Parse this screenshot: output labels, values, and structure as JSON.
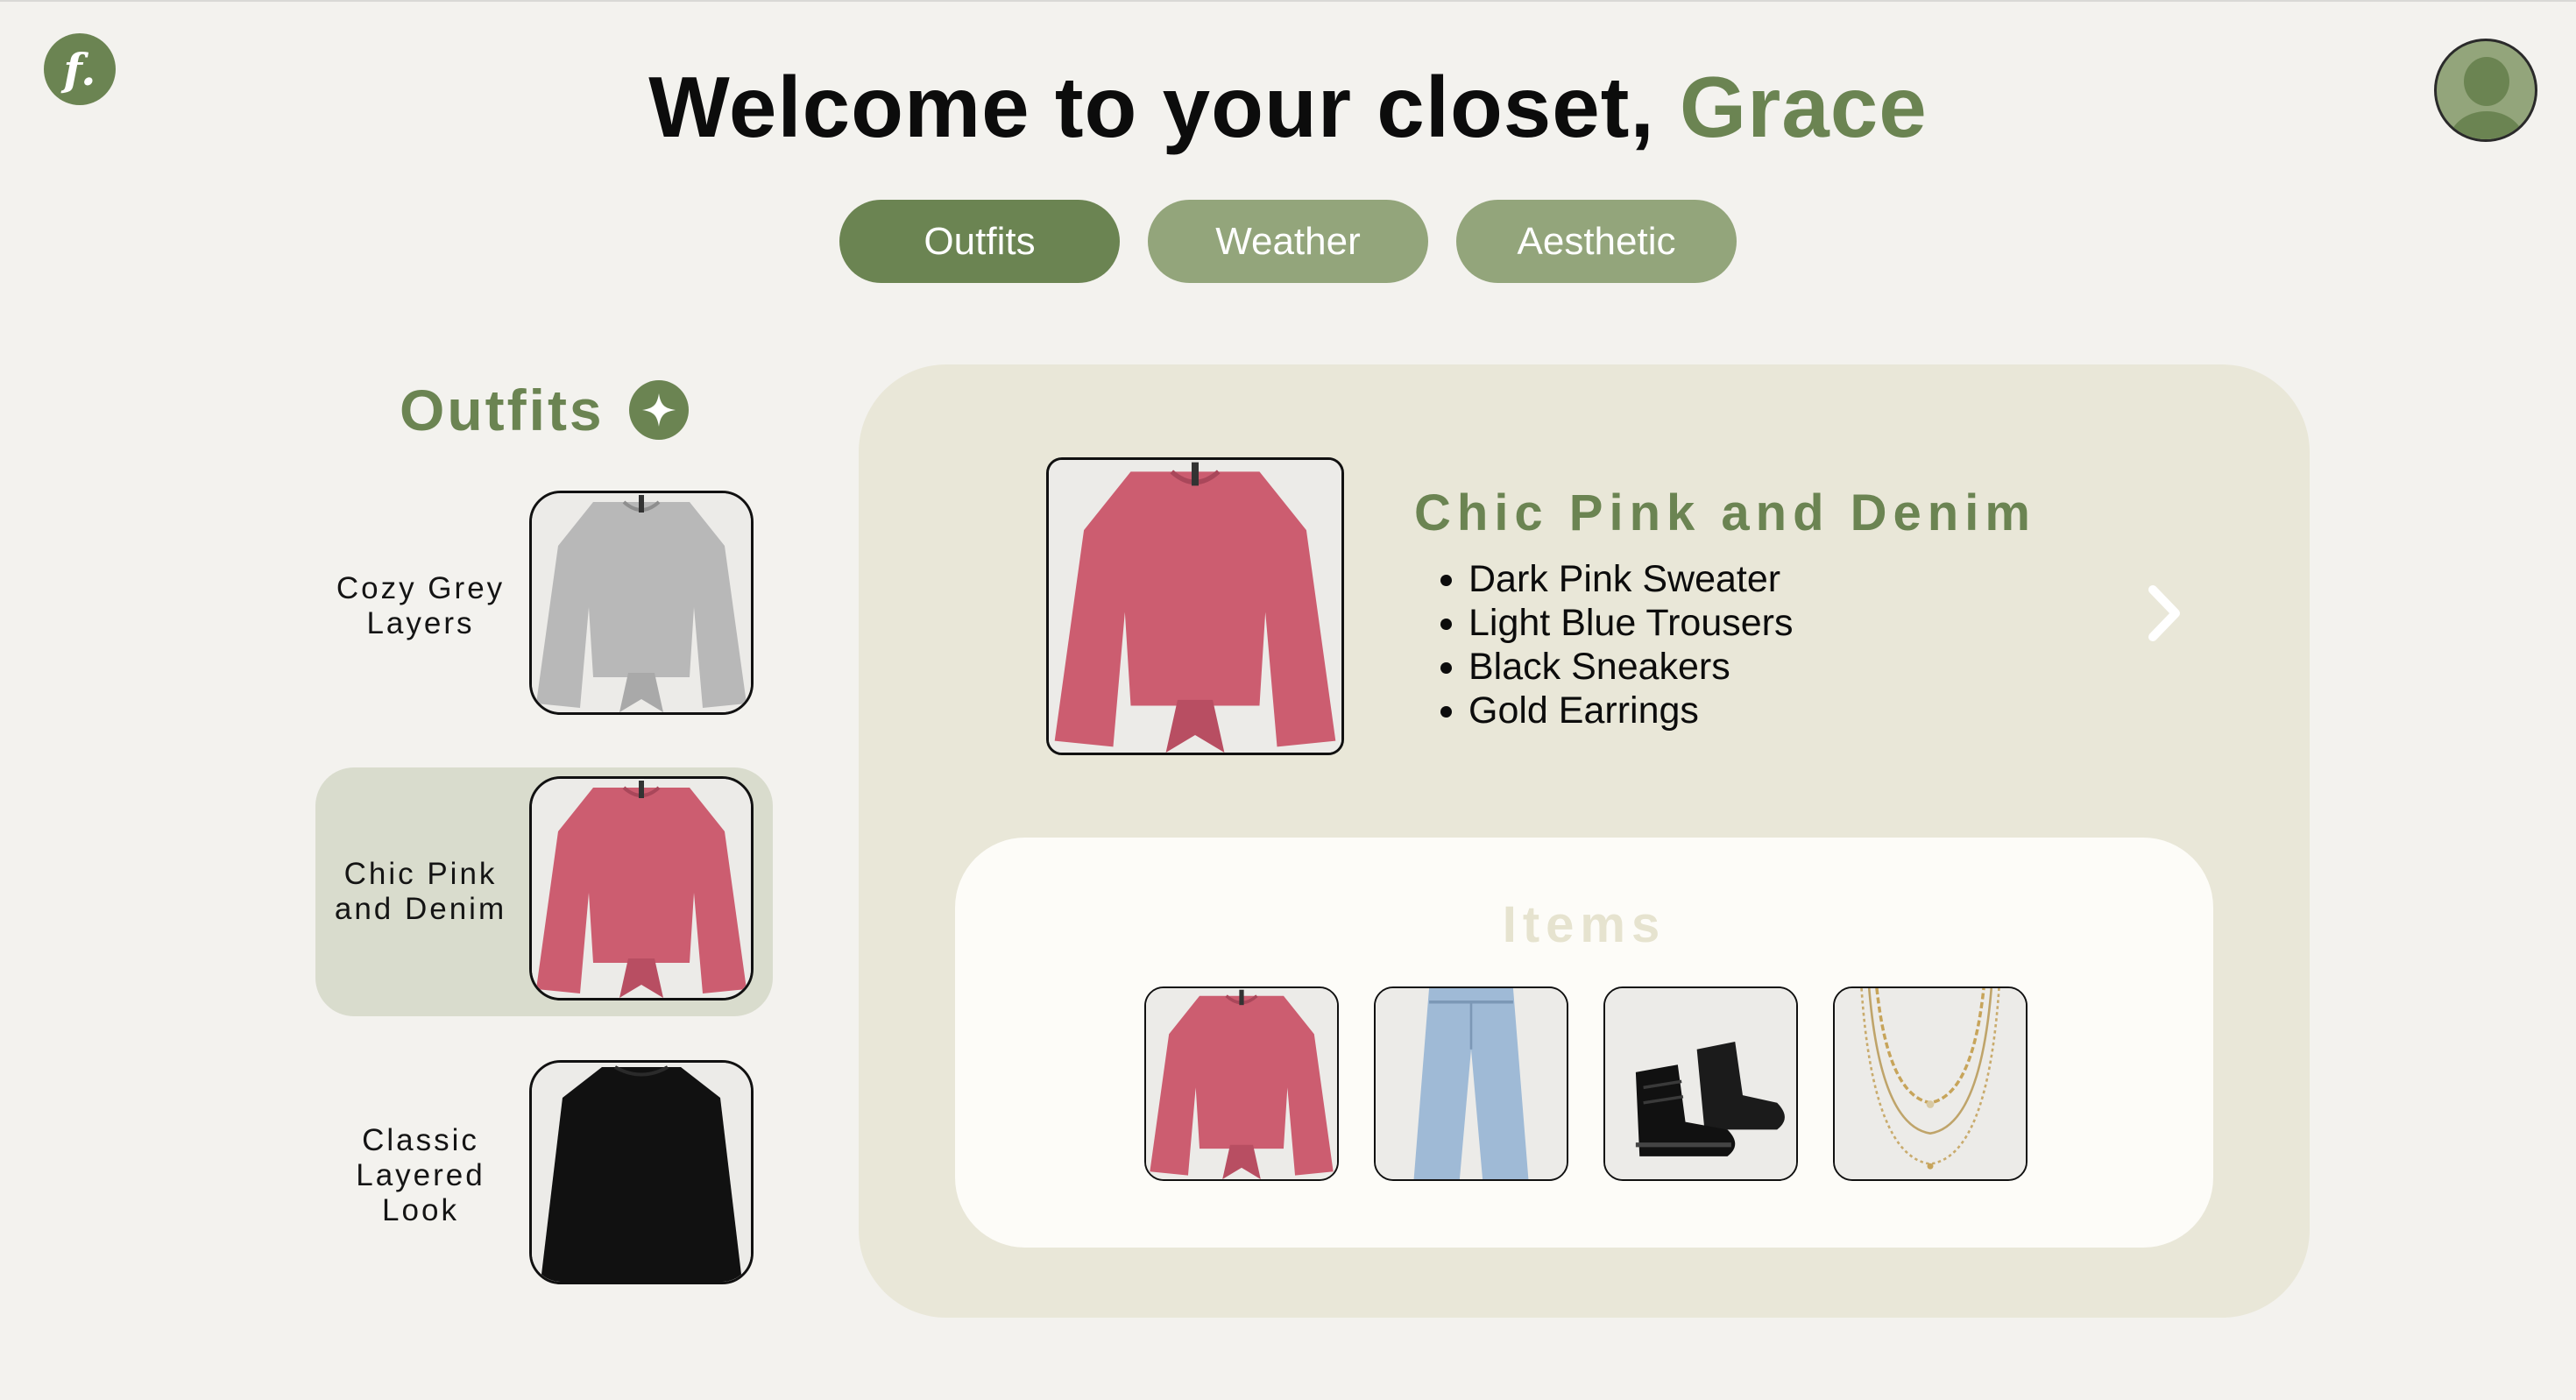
{
  "header": {
    "logo_text": "f.",
    "welcome_prefix": "Welcome to your closet,",
    "user_name": "Grace"
  },
  "tabs": [
    {
      "label": "Outfits",
      "active": true
    },
    {
      "label": "Weather",
      "active": false
    },
    {
      "label": "Aesthetic",
      "active": false
    }
  ],
  "sidebar": {
    "title": "Outfits",
    "outfits": [
      {
        "name": "Cozy Grey Layers",
        "image": "grey-sweater",
        "selected": false
      },
      {
        "name": "Chic Pink and Denim",
        "image": "pink-sweater",
        "selected": true
      },
      {
        "name": "Classic Layered Look",
        "image": "black-sweater",
        "selected": false
      }
    ]
  },
  "detail": {
    "title": "Chic Pink and Denim",
    "pieces": [
      "Dark Pink Sweater",
      "Light Blue Trousers",
      "Black Sneakers",
      "Gold Earrings"
    ],
    "items_title": "Items",
    "item_images": [
      "pink-sweater",
      "light-blue-jeans",
      "black-boots",
      "gold-necklace"
    ]
  },
  "colors": {
    "brand_green": "#6b8452",
    "tab_inactive": "#93a57b",
    "card_bg": "#e9e7d8",
    "selected_row": "#d9dccd",
    "page_bg": "#f3f2ee"
  }
}
